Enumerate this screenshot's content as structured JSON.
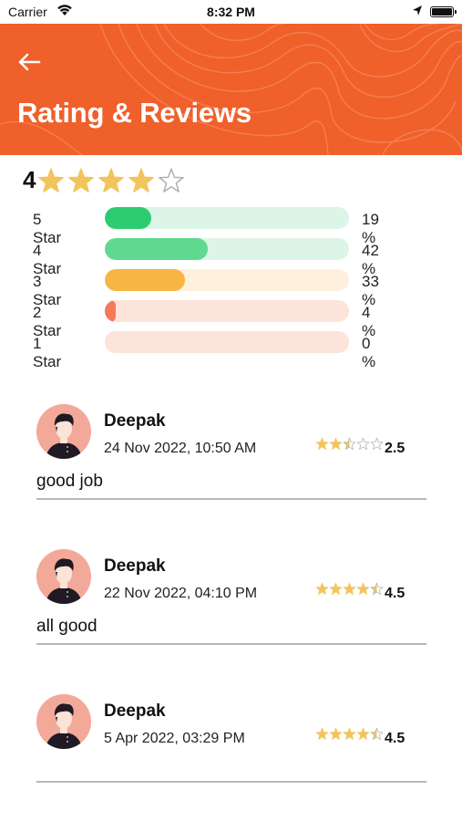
{
  "status_bar": {
    "carrier": "Carrier",
    "time": "8:32 PM"
  },
  "header": {
    "title": "Rating & Reviews",
    "color": "#f0602b"
  },
  "summary": {
    "average": "4",
    "stars": 4,
    "max_stars": 5
  },
  "breakdown": [
    {
      "label": "5 Star",
      "percent_text": "19 %",
      "fraction": 0.19,
      "fill": "#2ecc71",
      "track": "#dcf5e6"
    },
    {
      "label": "4 Star",
      "percent_text": "42 %",
      "fraction": 0.42,
      "fill": "#5fd890",
      "track": "#dcf5e6"
    },
    {
      "label": "3 Star",
      "percent_text": "33 %",
      "fraction": 0.33,
      "fill": "#f7b544",
      "track": "#fdf1dd"
    },
    {
      "label": "2 Star",
      "percent_text": "4 %",
      "fraction": 0.04,
      "fill": "#f47a5a",
      "track": "#fce3dc"
    },
    {
      "label": "1 Star",
      "percent_text": "0 %",
      "fraction": 0.0,
      "fill": "#f47a5a",
      "track": "#fce3dc"
    }
  ],
  "reviews": [
    {
      "name": "Deepak",
      "date": "24 Nov 2022, 10:50 AM",
      "rating": 2.5,
      "rating_text": "2.5",
      "comment": "good job"
    },
    {
      "name": "Deepak",
      "date": "22 Nov 2022, 04:10 PM",
      "rating": 4.5,
      "rating_text": "4.5",
      "comment": "all good"
    },
    {
      "name": "Deepak",
      "date": "5 Apr 2022, 03:29 PM",
      "rating": 4.5,
      "rating_text": "4.5",
      "comment": ""
    }
  ],
  "icons": {
    "back": "arrow-left-icon",
    "star": "star-icon",
    "avatar": "user-avatar",
    "wifi": "wifi-icon",
    "location": "location-arrow-icon",
    "battery": "battery-icon"
  }
}
